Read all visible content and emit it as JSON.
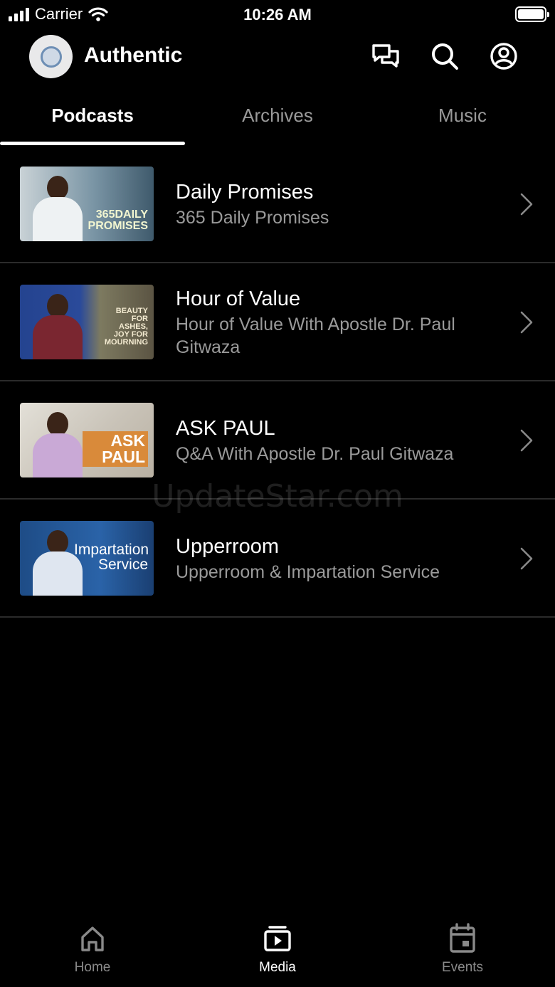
{
  "status_bar": {
    "carrier": "Carrier",
    "time": "10:26 AM"
  },
  "header": {
    "title": "Authentic"
  },
  "tabs": [
    {
      "label": "Podcasts",
      "active": true
    },
    {
      "label": "Archives",
      "active": false
    },
    {
      "label": "Music",
      "active": false
    }
  ],
  "podcasts": [
    {
      "title": "Daily Promises",
      "subtitle": "365 Daily Promises",
      "thumb_text": "365DAILY PROMISES"
    },
    {
      "title": "Hour of Value",
      "subtitle": "Hour of Value With Apostle Dr. Paul Gitwaza",
      "thumb_text": "BEAUTY FOR ASHES, JOY FOR MOURNING"
    },
    {
      "title": "ASK PAUL",
      "subtitle": "Q&A With Apostle Dr. Paul Gitwaza",
      "thumb_text": "ASK PAUL"
    },
    {
      "title": "Upperroom",
      "subtitle": "Upperroom & Impartation Service",
      "thumb_text": "Impartation Service"
    }
  ],
  "watermark": "UpdateStar.com",
  "tabbar": [
    {
      "label": "Home",
      "icon": "home-icon",
      "active": false
    },
    {
      "label": "Media",
      "icon": "media-icon",
      "active": true
    },
    {
      "label": "Events",
      "icon": "calendar-icon",
      "active": false
    }
  ],
  "colors": {
    "background": "#000000",
    "secondary_text": "#9a9a9a",
    "divider": "#2b2b2b"
  }
}
